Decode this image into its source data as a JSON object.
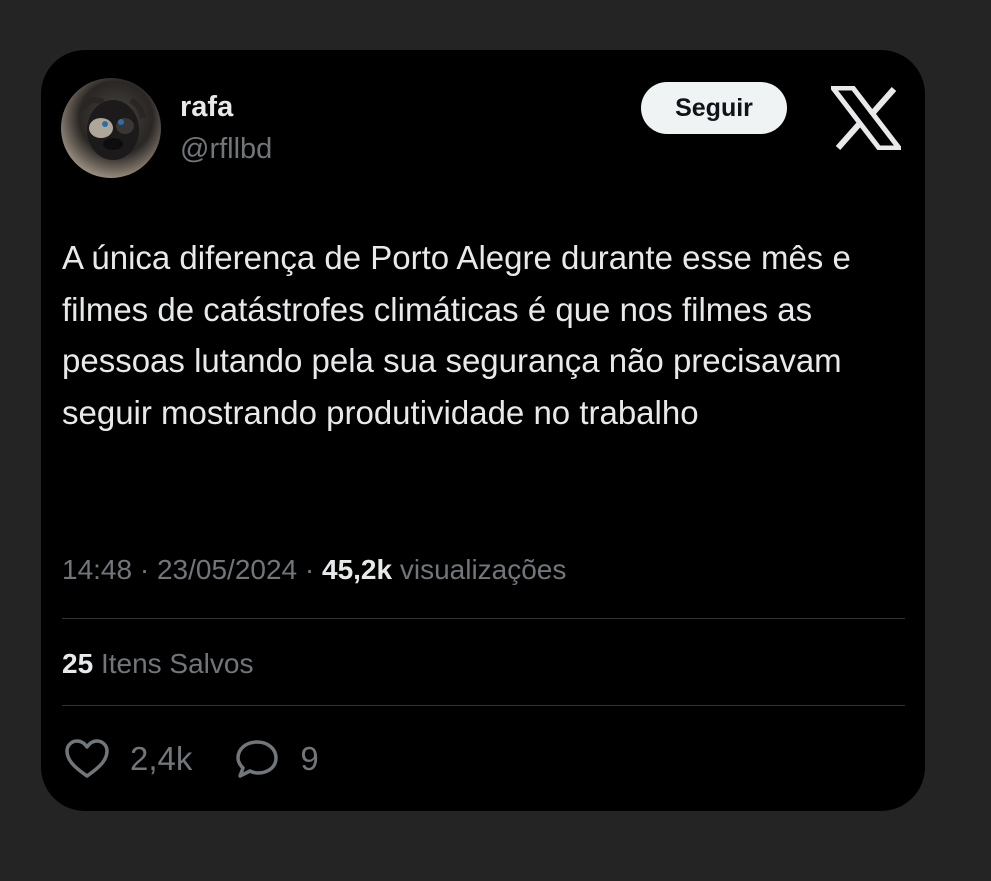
{
  "author": {
    "display_name": "rafa",
    "handle": "@rfllbd"
  },
  "follow_button_label": "Seguir",
  "tweet": {
    "text": "A única diferença de Porto Alegre durante esse mês e filmes de catástrofes climáticas é que nos filmes as pessoas lutando pela sua segurança não precisavam seguir mostrando produtividade no trabalho",
    "time": "14:48",
    "date": "23/05/2024",
    "separator": "·",
    "views_count": "45,2k",
    "views_label": "visualizações",
    "bookmarks_count": "25",
    "bookmarks_label": "Itens Salvos",
    "likes": "2,4k",
    "replies": "9"
  },
  "icons": {
    "brand": "x-logo-icon",
    "like": "heart-icon",
    "reply": "speech-bubble-icon"
  },
  "colors": {
    "background": "#242424",
    "card": "#000000",
    "text_primary": "#e7e9ea",
    "text_secondary": "#71767b",
    "divider": "#2f3336",
    "button_bg": "#eff3f4"
  }
}
